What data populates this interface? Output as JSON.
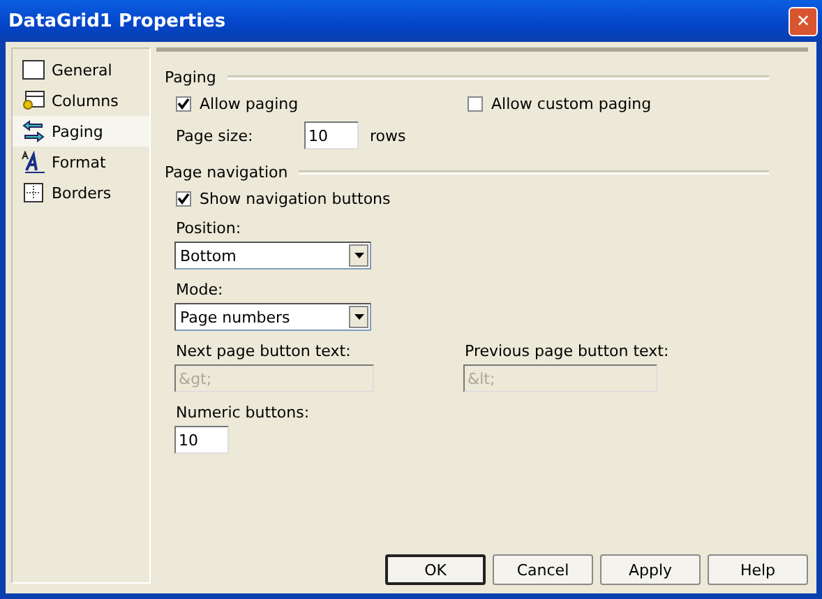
{
  "window": {
    "title": "DataGrid1 Properties",
    "close": "✕"
  },
  "sidebar": {
    "items": [
      {
        "label": "General",
        "selected": false
      },
      {
        "label": "Columns",
        "selected": false
      },
      {
        "label": "Paging",
        "selected": true
      },
      {
        "label": "Format",
        "selected": false
      },
      {
        "label": "Borders",
        "selected": false
      }
    ]
  },
  "paging": {
    "heading": "Paging",
    "allow_paging": {
      "label": "Allow paging",
      "checked": true
    },
    "allow_custom_paging": {
      "label": "Allow custom paging",
      "checked": false
    },
    "page_size": {
      "label": "Page size:",
      "value": "10",
      "unit": "rows"
    }
  },
  "navigation": {
    "heading": "Page navigation",
    "show_buttons": {
      "label": "Show navigation buttons",
      "checked": true
    },
    "position": {
      "label": "Position:",
      "value": "Bottom"
    },
    "mode": {
      "label": "Mode:",
      "value": "Page numbers"
    },
    "next_text": {
      "label": "Next page button text:",
      "value": "&gt;",
      "disabled": true
    },
    "prev_text": {
      "label": "Previous page button text:",
      "value": "&lt;",
      "disabled": true
    },
    "numeric_buttons": {
      "label": "Numeric buttons:",
      "value": "10"
    }
  },
  "buttons": [
    {
      "label": "OK",
      "default": true
    },
    {
      "label": "Cancel",
      "default": false
    },
    {
      "label": "Apply",
      "default": false
    },
    {
      "label": "Help",
      "default": false
    }
  ]
}
